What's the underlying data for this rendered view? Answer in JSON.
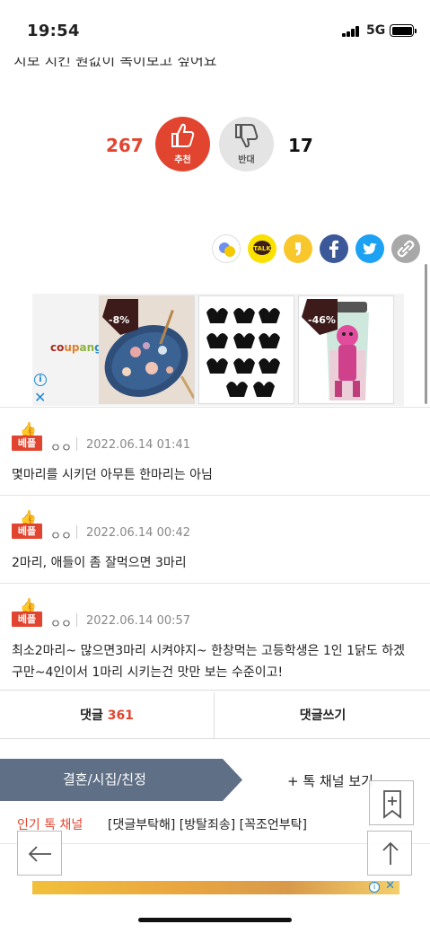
{
  "status_bar": {
    "time": "19:54",
    "network": "5G"
  },
  "post": {
    "cut_line": "치보 치킨 원값이 녹이보고 싶어요"
  },
  "vote": {
    "up_count": "267",
    "up_label": "추천",
    "down_count": "17",
    "down_label": "반대"
  },
  "share": [
    "kakaostory-icon",
    "kakaotalk-icon",
    "kakao-channel-icon",
    "facebook-icon",
    "twitter-icon",
    "link-icon"
  ],
  "share_texts": {
    "talk": "TALK"
  },
  "ad": {
    "brand": "coupang",
    "items": [
      {
        "discount": "-8%",
        "image": "floral-oval-plate"
      },
      {
        "discount": "",
        "image": "black-hair-claw-clips"
      },
      {
        "discount": "-46%",
        "image": "anime-character-tumbler"
      }
    ]
  },
  "comments": [
    {
      "badge": "베플",
      "author": "ㅇㅇ",
      "date": "2022.06.14 01:41",
      "text": "몇마리를 시키던 아무튼 한마리는 아님"
    },
    {
      "badge": "베플",
      "author": "ㅇㅇ",
      "date": "2022.06.14 00:42",
      "text": "2마리, 애들이 좀 잘먹으면 3마리"
    },
    {
      "badge": "베플",
      "author": "ㅇㅇ",
      "date": "2022.06.14 00:57",
      "text": "최소2마리~ 많으면3마리 시켜야지~ 한창먹는 고등학생은 1인 1닭도 하겠구만~4인이서 1마리 시키는건 맛만 보는 수준이고!"
    }
  ],
  "comment_bar": {
    "label": "댓글",
    "count": "361",
    "write_label": "댓글쓰기"
  },
  "channel_bar": {
    "current": "결혼/시집/친정",
    "more": "+ 톡 채널 보기"
  },
  "hot_channels": {
    "label": "인기 톡 채널",
    "items": "[댓글부탁해] [방탈죄송] [꼭조언부탁]"
  },
  "colors": {
    "accent": "#e2452f",
    "channel_bar": "#5e6f86",
    "facebook": "#3b5998",
    "twitter": "#1da1f2",
    "kakao": "#fae100"
  }
}
